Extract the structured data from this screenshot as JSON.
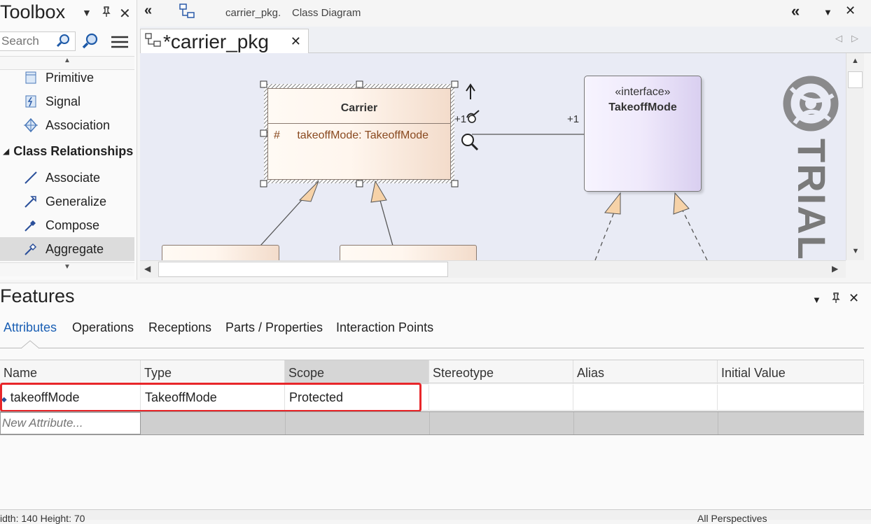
{
  "toolbox": {
    "title": "Toolbox",
    "search_placeholder": "Search",
    "items": [
      {
        "label": "Primitive",
        "icon": "primitive-icon"
      },
      {
        "label": "Signal",
        "icon": "signal-icon"
      },
      {
        "label": "Association",
        "icon": "association-icon"
      }
    ],
    "group_label": "Class Relationships",
    "relationships": [
      {
        "label": "Associate",
        "icon": "associate-icon"
      },
      {
        "label": "Generalize",
        "icon": "generalize-icon"
      },
      {
        "label": "Compose",
        "icon": "compose-icon"
      },
      {
        "label": "Aggregate",
        "icon": "aggregate-icon",
        "selected": true
      }
    ]
  },
  "document": {
    "header_path": "carrier_pkg.",
    "header_type": "Class Diagram",
    "tab_label": "*carrier_pkg"
  },
  "diagram": {
    "carrier": {
      "name": "Carrier",
      "attr_scope": "#",
      "attr_text": "takeoffMode: TakeoffMode"
    },
    "interface": {
      "stereotype": "«interface»",
      "name": "TakeoffMode"
    },
    "assoc_source_mult": "+1",
    "assoc_target_mult": "+1",
    "watermark": "TRIAL"
  },
  "features": {
    "title": "Features",
    "tabs": [
      "Attributes",
      "Operations",
      "Receptions",
      "Parts / Properties",
      "Interaction Points"
    ],
    "active_tab": "Attributes",
    "columns": [
      "Name",
      "Type",
      "Scope",
      "Stereotype",
      "Alias",
      "Initial Value"
    ],
    "rows": [
      {
        "name": "takeoffMode",
        "type": "TakeoffMode",
        "scope": "Protected",
        "stereotype": "",
        "alias": "",
        "initial": ""
      }
    ],
    "new_placeholder": "New Attribute..."
  },
  "status": {
    "left": "idth: 140   Height: 70",
    "right": "All Perspectives"
  },
  "colors": {
    "highlight": "#e8262a",
    "class_fill_end": "#f3dccb",
    "interface_fill_end": "#d9cff0",
    "canvas": "#e9ebf5"
  }
}
